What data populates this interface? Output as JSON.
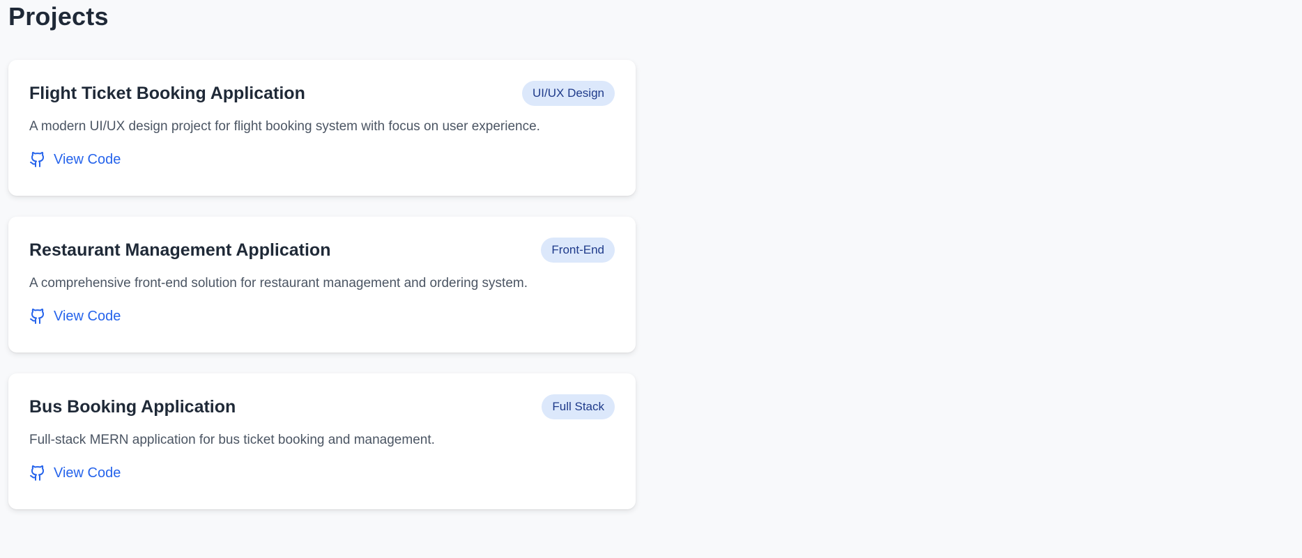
{
  "header": {
    "title": "Projects"
  },
  "theme": {
    "accent": "#2563eb",
    "badge_bg": "#dce8fb",
    "badge_text": "#1e3a8a"
  },
  "projects": [
    {
      "title": "Flight Ticket Booking Application",
      "badge": "UI/UX Design",
      "description": "A modern UI/UX design project for flight booking system with focus on user experience.",
      "link_label": "View Code",
      "link_icon": "github-icon"
    },
    {
      "title": "Restaurant Management Application",
      "badge": "Front-End",
      "description": "A comprehensive front-end solution for restaurant management and ordering system.",
      "link_label": "View Code",
      "link_icon": "github-icon"
    },
    {
      "title": "Bus Booking Application",
      "badge": "Full Stack",
      "description": "Full-stack MERN application for bus ticket booking and management.",
      "link_label": "View Code",
      "link_icon": "github-icon"
    }
  ]
}
